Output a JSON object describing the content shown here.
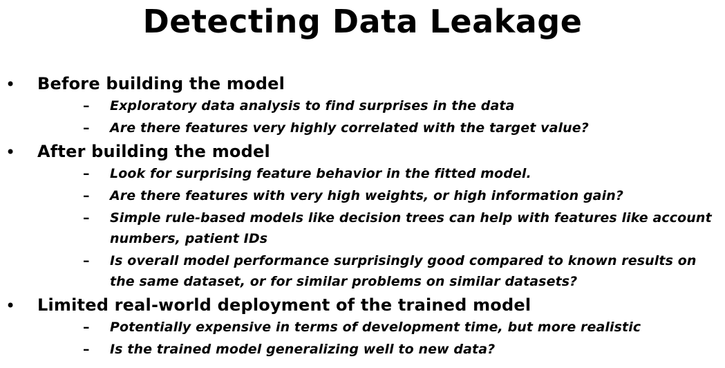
{
  "slide": {
    "title": "Detecting Data Leakage",
    "bullets": [
      {
        "marker": "•",
        "text": "Before building the model",
        "subs": [
          {
            "marker": "–",
            "text": "Exploratory data analysis to find surprises in the data"
          },
          {
            "marker": "–",
            "text": "Are there features very highly correlated with the target value?"
          }
        ]
      },
      {
        "marker": "•",
        "text": "After building the model",
        "subs": [
          {
            "marker": "–",
            "text": "Look for surprising feature behavior in the fitted model."
          },
          {
            "marker": "–",
            "text": "Are there features with very high weights, or high information gain?"
          },
          {
            "marker": "–",
            "text": "Simple rule-based models like decision trees can help with features like account numbers, patient IDs"
          },
          {
            "marker": "–",
            "text": "Is overall model performance surprisingly good compared to known results on the same dataset, or for similar problems on similar datasets?"
          }
        ]
      },
      {
        "marker": "•",
        "text": "Limited real-world deployment of the trained model",
        "subs": [
          {
            "marker": "–",
            "text": "Potentially expensive in terms of development time, but more realistic"
          },
          {
            "marker": "–",
            "text": "Is the trained model generalizing well to new data?"
          }
        ]
      }
    ]
  }
}
